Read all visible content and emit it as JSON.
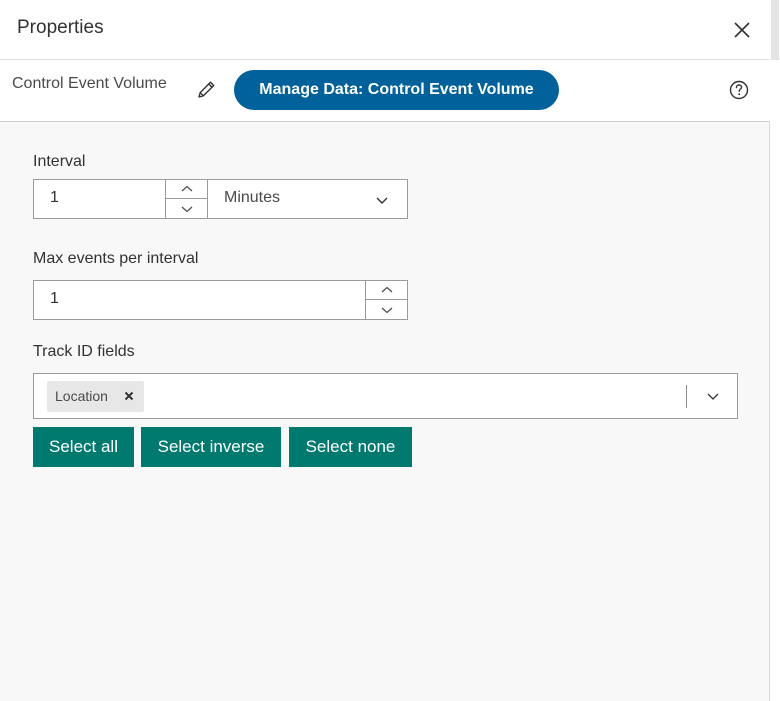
{
  "header": {
    "title": "Properties"
  },
  "subheader": {
    "node_name": "Control Event Volume",
    "manage_button": "Manage Data: Control Event Volume"
  },
  "form": {
    "interval": {
      "label": "Interval",
      "value": "1",
      "unit": "Minutes"
    },
    "max_events": {
      "label": "Max events per interval",
      "value": "1"
    },
    "track_id": {
      "label": "Track ID fields",
      "selected": [
        "Location"
      ]
    },
    "buttons": {
      "select_all": "Select all",
      "select_inverse": "Select inverse",
      "select_none": "Select none"
    }
  },
  "colors": {
    "manage_button_bg": "#00619b",
    "action_button_bg": "#00796f"
  },
  "icons": {
    "close": "close-icon",
    "edit": "pencil-icon",
    "help": "question-circle-icon",
    "chevron_up": "chevron-up-icon",
    "chevron_down": "chevron-down-icon",
    "chip_remove": "x-icon"
  }
}
